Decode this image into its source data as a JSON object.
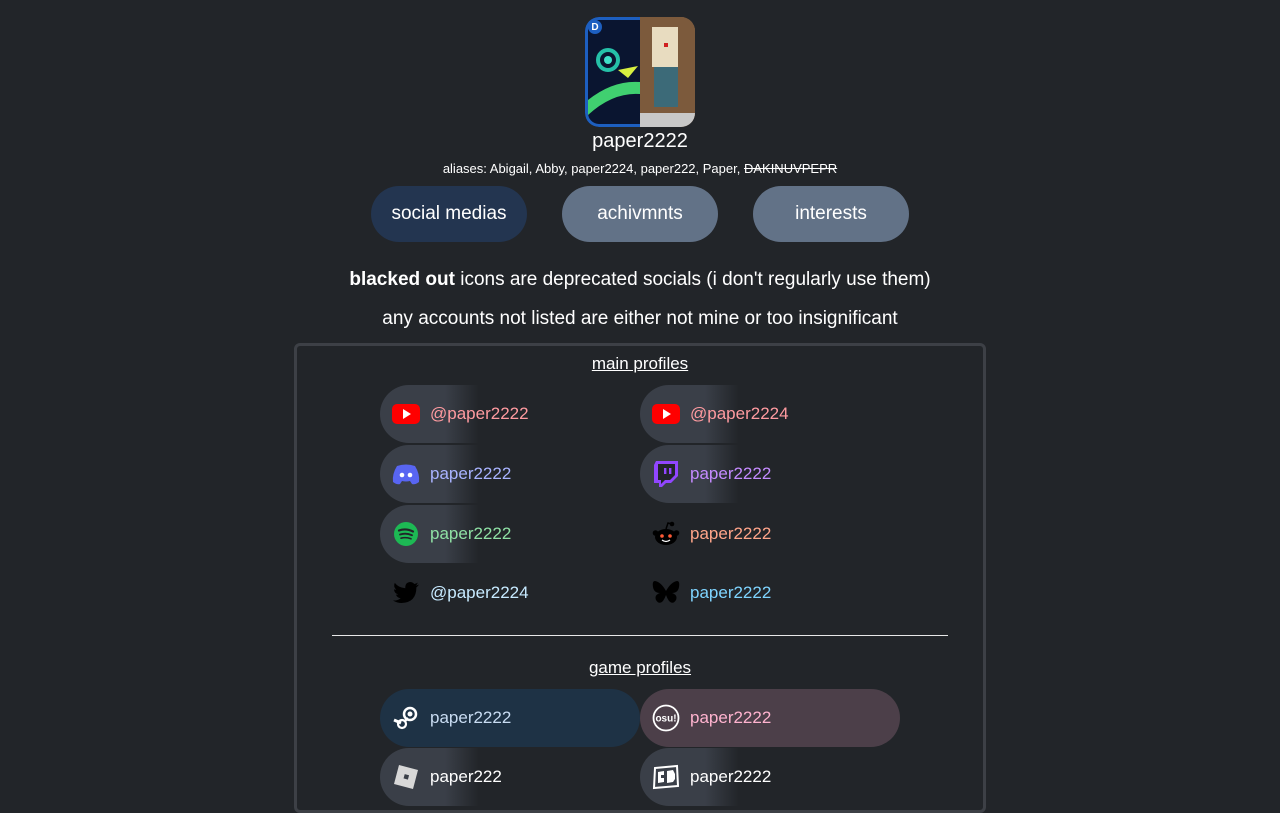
{
  "profile": {
    "username": "paper2222",
    "aliases_prefix": "aliases: Abigail, Abby, paper2224, paper222, Paper, ",
    "aliases_struck": "DAKINUVPEPR"
  },
  "tabs": [
    {
      "label": "social medias",
      "active": true
    },
    {
      "label": "achivmnts",
      "active": false
    },
    {
      "label": "interests",
      "active": false
    }
  ],
  "notes": {
    "line1_bold": "blacked out",
    "line1_rest": " icons are deprecated socials (i don't regularly use them)",
    "line2": "any accounts not listed are either not mine or too insignificant"
  },
  "sections": {
    "main_title": "main profiles",
    "game_title": "game profiles"
  },
  "main_profiles": [
    {
      "icon": "youtube-icon",
      "label": "@paper2222",
      "color": "#ff9ba0"
    },
    {
      "icon": "youtube-icon",
      "label": "@paper2224",
      "color": "#ff9ba0"
    },
    {
      "icon": "discord-icon",
      "label": "paper2222",
      "color": "#a9b3ff"
    },
    {
      "icon": "twitch-icon",
      "label": "paper2222",
      "color": "#c58bff"
    },
    {
      "icon": "spotify-icon",
      "label": "paper2222",
      "color": "#8fe0a4"
    },
    {
      "icon": "reddit-icon",
      "label": "paper2222",
      "color": "#ffa58a"
    },
    {
      "icon": "twitter-icon",
      "label": "@paper2224",
      "color": "#c7eaff"
    },
    {
      "icon": "bluesky-icon",
      "label": "paper2222",
      "color": "#7fd4ff"
    }
  ],
  "game_profiles": [
    {
      "icon": "steam-icon",
      "label": "paper2222",
      "color": "#c9dcf2"
    },
    {
      "icon": "osu-icon",
      "label": "paper2222",
      "color": "#ffb3cf"
    },
    {
      "icon": "roblox-icon",
      "label": "paper222",
      "color": "#ffffff"
    },
    {
      "icon": "geometry-dash-icon",
      "label": "paper2222",
      "color": "#ffffff"
    }
  ]
}
